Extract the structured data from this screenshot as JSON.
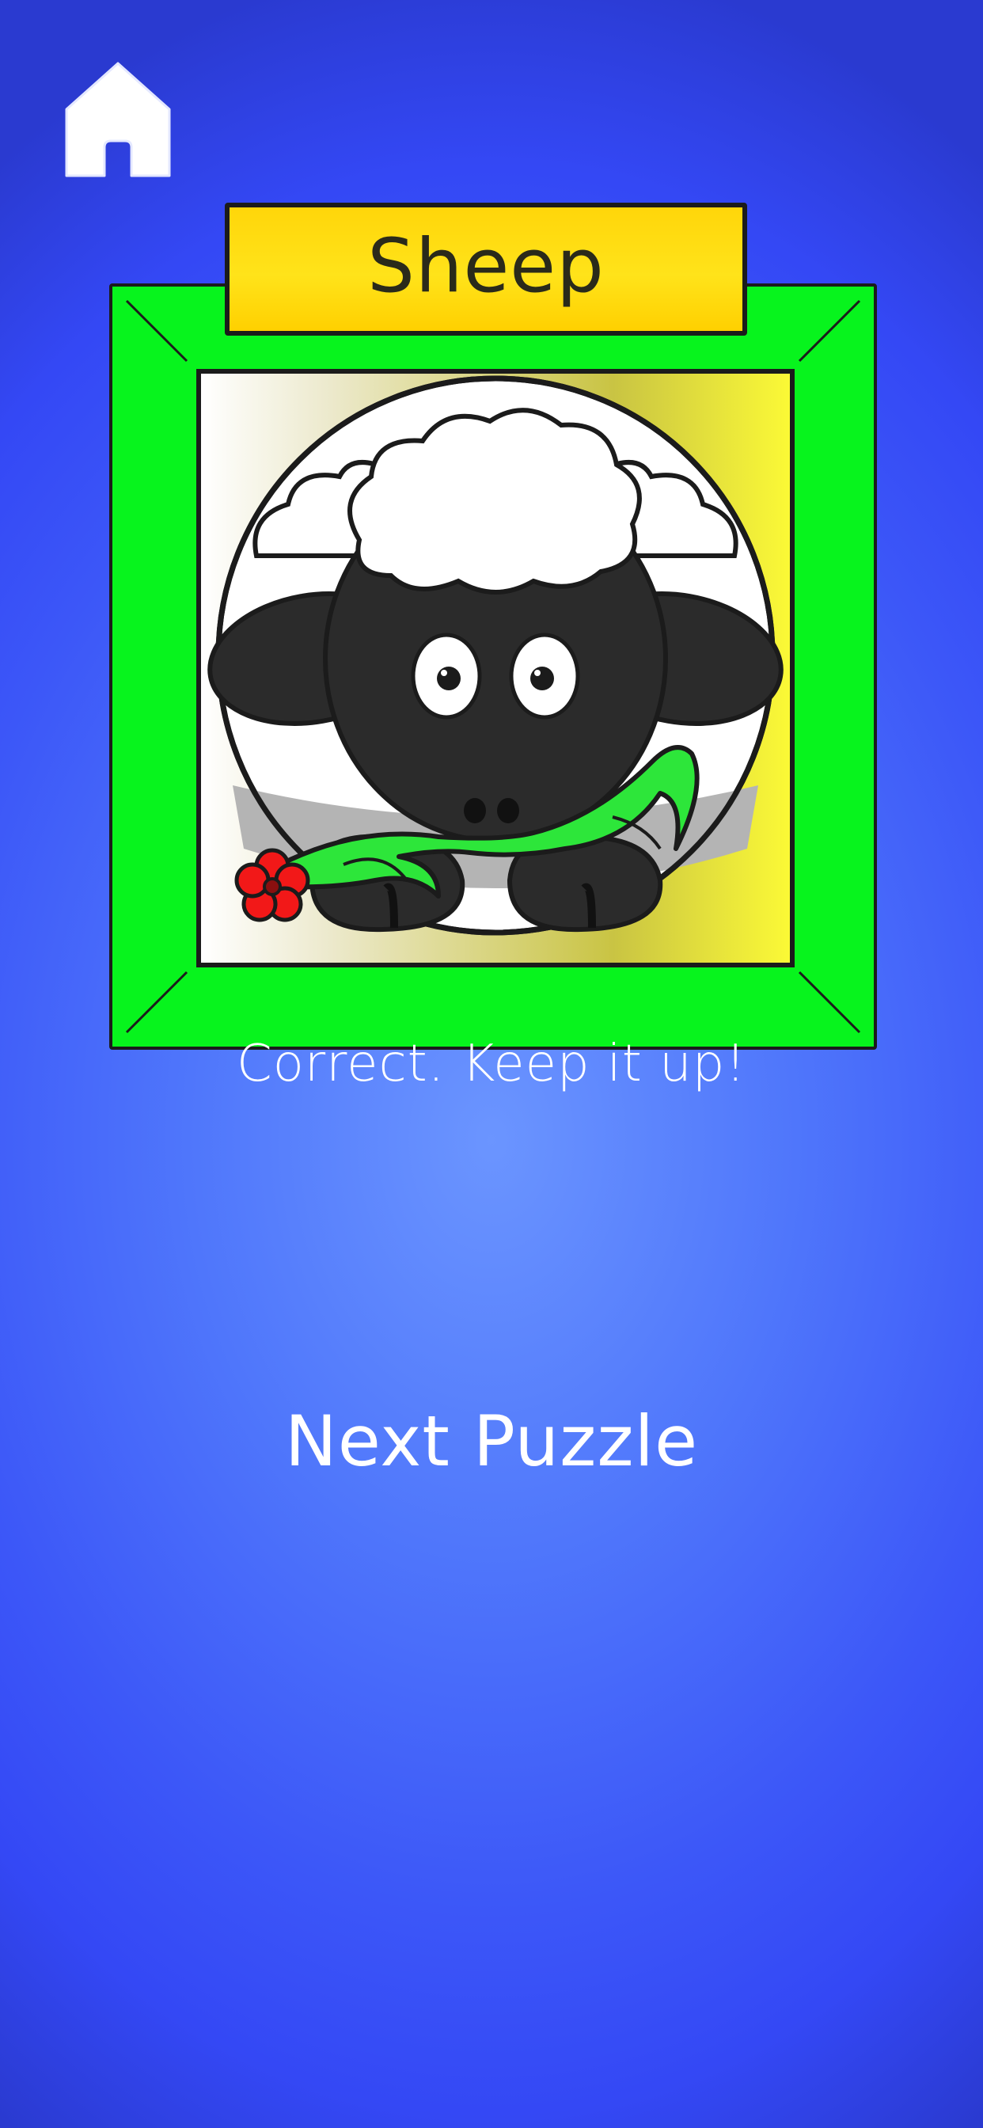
{
  "screen": {
    "background_colors": [
      "#6b95ff",
      "#3c57f8",
      "#2a3ad0"
    ]
  },
  "toolbar": {
    "home_icon": "home-icon"
  },
  "puzzle": {
    "title": "Sheep",
    "image": "sheep-illustration",
    "frame_color": "#07f41d",
    "title_plate_color": "#ffd60a"
  },
  "feedback": {
    "message": "Correct. Keep it up!"
  },
  "actions": {
    "next_label": "Next Puzzle"
  }
}
